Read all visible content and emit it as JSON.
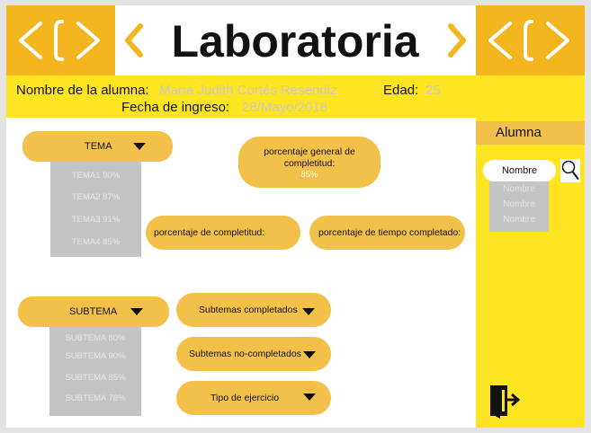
{
  "header": {
    "brand": "Laboratoria",
    "logo_left_icon": "code-brackets-icon",
    "logo_right_icon": "code-brackets-icon"
  },
  "student_info": {
    "name_label": "Nombre de la alumna:",
    "name_value": "María Judith Cortés Resendiz",
    "age_label": "Edad:",
    "age_value": "25",
    "date_label": "Fecha de ingreso:",
    "date_value": "28/Mayo/2018"
  },
  "tema": {
    "label": "TEMA",
    "items": [
      "TEMA1  90%",
      "TEMA2  87%",
      "TEMA3  91%",
      "TEMA4  85%"
    ]
  },
  "stats": {
    "general_label": "porcentaje general de completitud:",
    "general_value": "85%",
    "completitud_label": "porcentaje de completitud:",
    "tiempo_label": "porcentaje de tiempo completado:"
  },
  "subtema": {
    "label": "SUBTEMA",
    "items": [
      "SUBTEMA  80%",
      "SUBTEMA 90%",
      "SUBTEMA  85%",
      "SUBTEMA 78%"
    ]
  },
  "filters": {
    "completed": "Subtemas completados",
    "not_completed": "Subtemas no-completados",
    "exercise_type": "Tipo de ejercicio"
  },
  "sidebar": {
    "title": "Alumna",
    "search_value": "Nombre",
    "names": [
      "Nombre",
      "Nombre",
      "Nombre"
    ],
    "search_icon": "magnifier-icon",
    "exit_icon": "exit-door-icon"
  },
  "colors": {
    "yellow": "#ffe521",
    "orange": "#f3b61f",
    "pill": "#f3c04a",
    "gray": "#c4c4c4"
  }
}
